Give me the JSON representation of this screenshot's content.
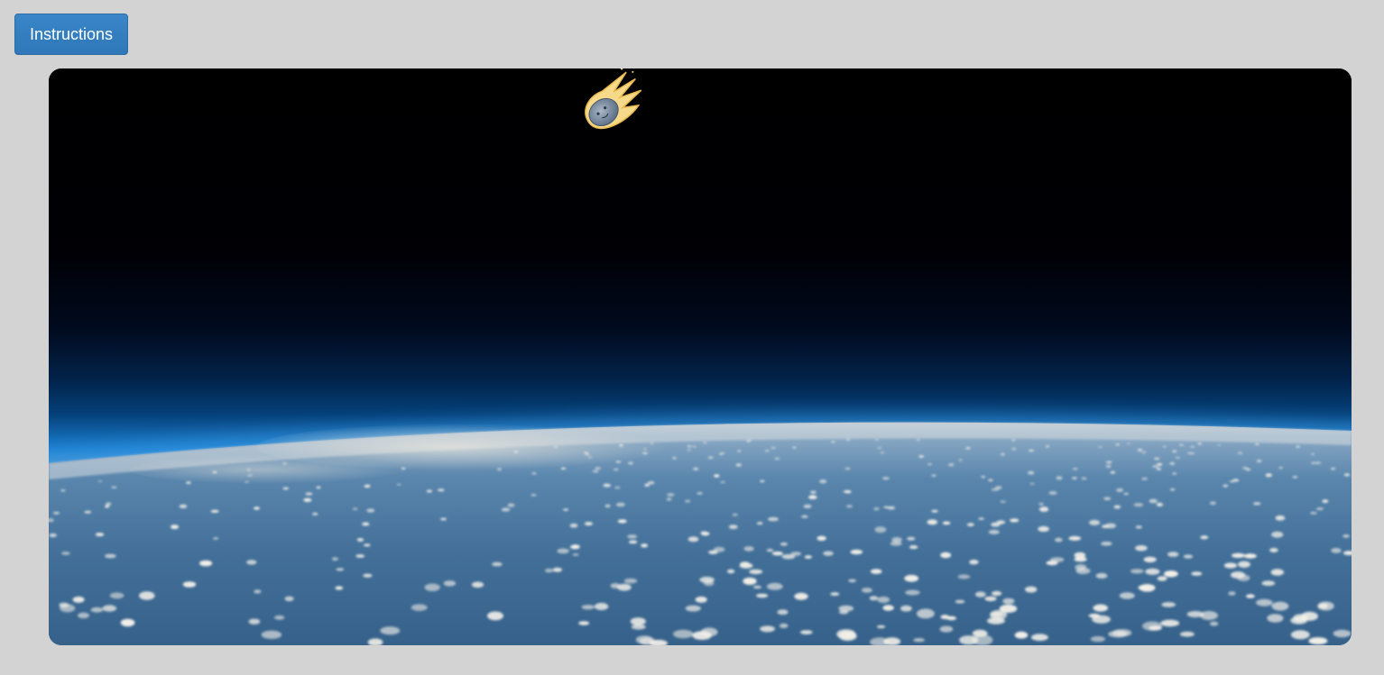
{
  "toolbar": {
    "instructions_label": "Instructions"
  },
  "game": {
    "background": "earth-horizon-from-space",
    "player": "meteor-icon",
    "colors": {
      "space": "#000000",
      "atmosphere": "#1c7fd0",
      "ocean": "#3d6a93",
      "meteor_flame": "#f7d98a",
      "meteor_rock": "#7d8fa6",
      "page_background": "#d3d3d3",
      "button": "#337ab7"
    }
  }
}
